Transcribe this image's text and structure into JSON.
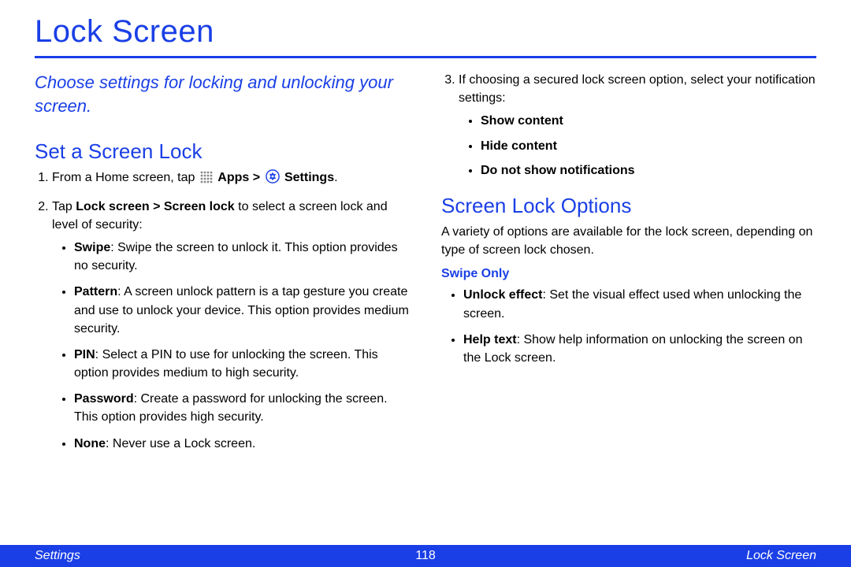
{
  "title": "Lock Screen",
  "intro": "Choose settings for locking and unlocking your screen.",
  "section1": {
    "heading": "Set a Screen Lock",
    "step1_prefix": "From a Home screen, tap ",
    "apps_icon_name": "apps-grid",
    "apps_label": "Apps",
    "gt": " > ",
    "settings_icon_name": "settings-gear",
    "settings_label": "Settings",
    "period": ".",
    "step2_prefix": "Tap ",
    "step2_bold": "Lock screen > Screen lock",
    "step2_suffix": " to select a screen lock and level of security:",
    "options": [
      {
        "name": "Swipe",
        "desc": ": Swipe the screen to unlock it. This option provides no security."
      },
      {
        "name": "Pattern",
        "desc": ": A screen unlock pattern is a tap gesture you create and use to unlock your device. This option provides medium security."
      },
      {
        "name": "PIN",
        "desc": ": Select a PIN to use for unlocking the screen. This option provides medium to high security."
      },
      {
        "name": "Password",
        "desc": ": Create a password for unlocking the screen. This option provides high security."
      },
      {
        "name": "None",
        "desc": ": Never use a Lock screen."
      }
    ],
    "step3": "If choosing a secured lock screen option, select your notification settings:",
    "notif_options": [
      "Show content",
      "Hide content",
      "Do not show notifications"
    ]
  },
  "section2": {
    "heading": "Screen Lock Options",
    "intro": "A variety of options are available for the lock screen, depending on type of screen lock chosen.",
    "swipe_only_label": "Swipe Only",
    "swipe_only_items": [
      {
        "name": "Unlock effect",
        "desc": ": Set the visual effect used when unlocking the screen."
      },
      {
        "name": "Help text",
        "desc": ": Show help information on unlocking the screen on the Lock screen."
      }
    ]
  },
  "footer": {
    "left": "Settings",
    "page": "118",
    "right": "Lock Screen"
  }
}
